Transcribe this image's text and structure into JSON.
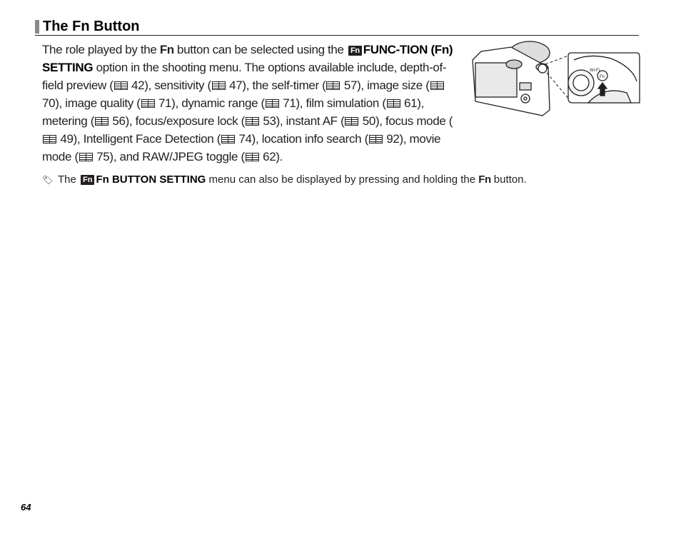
{
  "section": {
    "title": "The Fn Button"
  },
  "paragraph": {
    "t1": "The role played by the ",
    "fn1": "Fn",
    "t2": " button can be selected using the ",
    "fn_badge": "Fn",
    "menu_name": "FUNC-TION (Fn) SETTING",
    "t3": " option in the shooting menu. The options available include, depth-of-field preview (",
    "p1": "42",
    "t4": "), sensitivity (",
    "p2": "47",
    "t5": "), the self-timer (",
    "p3": "57",
    "t6": "), image size (",
    "p4": "70",
    "t7": "), image quality (",
    "p5": "71",
    "t8": "), dynamic range (",
    "p6": "71",
    "t9": "), film simulation (",
    "p7": "61",
    "t10": "), metering (",
    "p8": "56",
    "t11": "), focus/exposure lock (",
    "p9": "53",
    "t12": "), instant AF (",
    "p10": "50",
    "t13": "), focus mode (",
    "p11": "49",
    "t14": "), Intelligent Face Detection (",
    "p12": "74",
    "t15": "), location info search (",
    "p13": "92",
    "t16": "), movie mode (",
    "p14": "75",
    "t17": "), and RAW/JPEG toggle (",
    "p15": "62",
    "t18": ")."
  },
  "note": {
    "icon": "tag-icon",
    "t1": "The ",
    "fn_badge": "Fn",
    "menu_name": "Fn BUTTON  SETTING",
    "t2": " menu can also be displayed by pressing and holding the ",
    "fn": "Fn",
    "t3": " button."
  },
  "illustration": {
    "wifi_label": "Wi-Fi",
    "fn_label": "Fn"
  },
  "page_number": "64"
}
